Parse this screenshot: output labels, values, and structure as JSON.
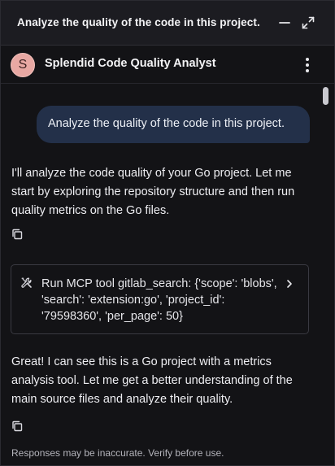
{
  "window": {
    "title": "Analyze the quality of the code in this project."
  },
  "agent": {
    "avatar_letter": "S",
    "name": "Splendid Code Quality Analyst"
  },
  "conversation": {
    "user_message": "Analyze the quality of the code in this project.",
    "assistant_message_1": "I'll analyze the code quality of your Go project. Let me start by exploring the repository structure and then run quality metrics on the Go files.",
    "tool_call": "Run MCP tool gitlab_search: {'scope': 'blobs', 'search': 'extension:go', 'project_id': '79598360', 'per_page': 50}",
    "assistant_message_2": "Great! I can see this is a Go project with a metrics analysis tool. Let me get a better understanding of the main source files and analyze their quality."
  },
  "footer": {
    "disclaimer": "Responses may be inaccurate. Verify before use."
  },
  "icons": {
    "minimize": "minimize-icon",
    "expand": "expand-icon",
    "menu": "kebab-menu-icon",
    "copy": "copy-icon",
    "tool": "tools-icon",
    "chevron": "chevron-right-icon"
  },
  "colors": {
    "background": "#131316",
    "titlebar": "#1c1c21",
    "user_bubble": "#233049",
    "avatar": "#e8a8a3"
  }
}
